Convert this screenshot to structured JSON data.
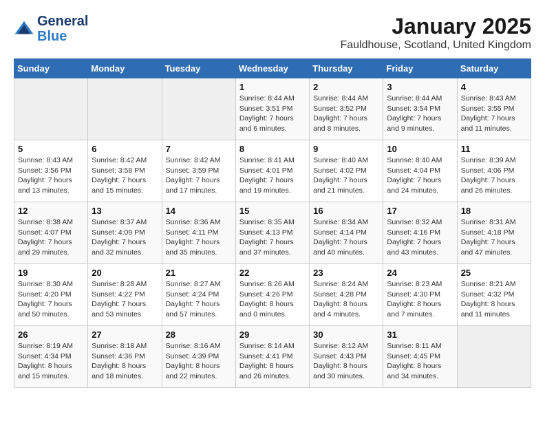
{
  "header": {
    "logo_line1": "General",
    "logo_line2": "Blue",
    "month": "January 2025",
    "location": "Fauldhouse, Scotland, United Kingdom"
  },
  "weekdays": [
    "Sunday",
    "Monday",
    "Tuesday",
    "Wednesday",
    "Thursday",
    "Friday",
    "Saturday"
  ],
  "weeks": [
    [
      {
        "day": "",
        "sunrise": "",
        "sunset": "",
        "daylight": ""
      },
      {
        "day": "",
        "sunrise": "",
        "sunset": "",
        "daylight": ""
      },
      {
        "day": "",
        "sunrise": "",
        "sunset": "",
        "daylight": ""
      },
      {
        "day": "1",
        "sunrise": "Sunrise: 8:44 AM",
        "sunset": "Sunset: 3:51 PM",
        "daylight": "Daylight: 7 hours and 6 minutes."
      },
      {
        "day": "2",
        "sunrise": "Sunrise: 8:44 AM",
        "sunset": "Sunset: 3:52 PM",
        "daylight": "Daylight: 7 hours and 8 minutes."
      },
      {
        "day": "3",
        "sunrise": "Sunrise: 8:44 AM",
        "sunset": "Sunset: 3:54 PM",
        "daylight": "Daylight: 7 hours and 9 minutes."
      },
      {
        "day": "4",
        "sunrise": "Sunrise: 8:43 AM",
        "sunset": "Sunset: 3:55 PM",
        "daylight": "Daylight: 7 hours and 11 minutes."
      }
    ],
    [
      {
        "day": "5",
        "sunrise": "Sunrise: 8:43 AM",
        "sunset": "Sunset: 3:56 PM",
        "daylight": "Daylight: 7 hours and 13 minutes."
      },
      {
        "day": "6",
        "sunrise": "Sunrise: 8:42 AM",
        "sunset": "Sunset: 3:58 PM",
        "daylight": "Daylight: 7 hours and 15 minutes."
      },
      {
        "day": "7",
        "sunrise": "Sunrise: 8:42 AM",
        "sunset": "Sunset: 3:59 PM",
        "daylight": "Daylight: 7 hours and 17 minutes."
      },
      {
        "day": "8",
        "sunrise": "Sunrise: 8:41 AM",
        "sunset": "Sunset: 4:01 PM",
        "daylight": "Daylight: 7 hours and 19 minutes."
      },
      {
        "day": "9",
        "sunrise": "Sunrise: 8:40 AM",
        "sunset": "Sunset: 4:02 PM",
        "daylight": "Daylight: 7 hours and 21 minutes."
      },
      {
        "day": "10",
        "sunrise": "Sunrise: 8:40 AM",
        "sunset": "Sunset: 4:04 PM",
        "daylight": "Daylight: 7 hours and 24 minutes."
      },
      {
        "day": "11",
        "sunrise": "Sunrise: 8:39 AM",
        "sunset": "Sunset: 4:06 PM",
        "daylight": "Daylight: 7 hours and 26 minutes."
      }
    ],
    [
      {
        "day": "12",
        "sunrise": "Sunrise: 8:38 AM",
        "sunset": "Sunset: 4:07 PM",
        "daylight": "Daylight: 7 hours and 29 minutes."
      },
      {
        "day": "13",
        "sunrise": "Sunrise: 8:37 AM",
        "sunset": "Sunset: 4:09 PM",
        "daylight": "Daylight: 7 hours and 32 minutes."
      },
      {
        "day": "14",
        "sunrise": "Sunrise: 8:36 AM",
        "sunset": "Sunset: 4:11 PM",
        "daylight": "Daylight: 7 hours and 35 minutes."
      },
      {
        "day": "15",
        "sunrise": "Sunrise: 8:35 AM",
        "sunset": "Sunset: 4:13 PM",
        "daylight": "Daylight: 7 hours and 37 minutes."
      },
      {
        "day": "16",
        "sunrise": "Sunrise: 8:34 AM",
        "sunset": "Sunset: 4:14 PM",
        "daylight": "Daylight: 7 hours and 40 minutes."
      },
      {
        "day": "17",
        "sunrise": "Sunrise: 8:32 AM",
        "sunset": "Sunset: 4:16 PM",
        "daylight": "Daylight: 7 hours and 43 minutes."
      },
      {
        "day": "18",
        "sunrise": "Sunrise: 8:31 AM",
        "sunset": "Sunset: 4:18 PM",
        "daylight": "Daylight: 7 hours and 47 minutes."
      }
    ],
    [
      {
        "day": "19",
        "sunrise": "Sunrise: 8:30 AM",
        "sunset": "Sunset: 4:20 PM",
        "daylight": "Daylight: 7 hours and 50 minutes."
      },
      {
        "day": "20",
        "sunrise": "Sunrise: 8:28 AM",
        "sunset": "Sunset: 4:22 PM",
        "daylight": "Daylight: 7 hours and 53 minutes."
      },
      {
        "day": "21",
        "sunrise": "Sunrise: 8:27 AM",
        "sunset": "Sunset: 4:24 PM",
        "daylight": "Daylight: 7 hours and 57 minutes."
      },
      {
        "day": "22",
        "sunrise": "Sunrise: 8:26 AM",
        "sunset": "Sunset: 4:26 PM",
        "daylight": "Daylight: 8 hours and 0 minutes."
      },
      {
        "day": "23",
        "sunrise": "Sunrise: 8:24 AM",
        "sunset": "Sunset: 4:28 PM",
        "daylight": "Daylight: 8 hours and 4 minutes."
      },
      {
        "day": "24",
        "sunrise": "Sunrise: 8:23 AM",
        "sunset": "Sunset: 4:30 PM",
        "daylight": "Daylight: 8 hours and 7 minutes."
      },
      {
        "day": "25",
        "sunrise": "Sunrise: 8:21 AM",
        "sunset": "Sunset: 4:32 PM",
        "daylight": "Daylight: 8 hours and 11 minutes."
      }
    ],
    [
      {
        "day": "26",
        "sunrise": "Sunrise: 8:19 AM",
        "sunset": "Sunset: 4:34 PM",
        "daylight": "Daylight: 8 hours and 15 minutes."
      },
      {
        "day": "27",
        "sunrise": "Sunrise: 8:18 AM",
        "sunset": "Sunset: 4:36 PM",
        "daylight": "Daylight: 8 hours and 18 minutes."
      },
      {
        "day": "28",
        "sunrise": "Sunrise: 8:16 AM",
        "sunset": "Sunset: 4:39 PM",
        "daylight": "Daylight: 8 hours and 22 minutes."
      },
      {
        "day": "29",
        "sunrise": "Sunrise: 8:14 AM",
        "sunset": "Sunset: 4:41 PM",
        "daylight": "Daylight: 8 hours and 26 minutes."
      },
      {
        "day": "30",
        "sunrise": "Sunrise: 8:12 AM",
        "sunset": "Sunset: 4:43 PM",
        "daylight": "Daylight: 8 hours and 30 minutes."
      },
      {
        "day": "31",
        "sunrise": "Sunrise: 8:11 AM",
        "sunset": "Sunset: 4:45 PM",
        "daylight": "Daylight: 8 hours and 34 minutes."
      },
      {
        "day": "",
        "sunrise": "",
        "sunset": "",
        "daylight": ""
      }
    ]
  ]
}
